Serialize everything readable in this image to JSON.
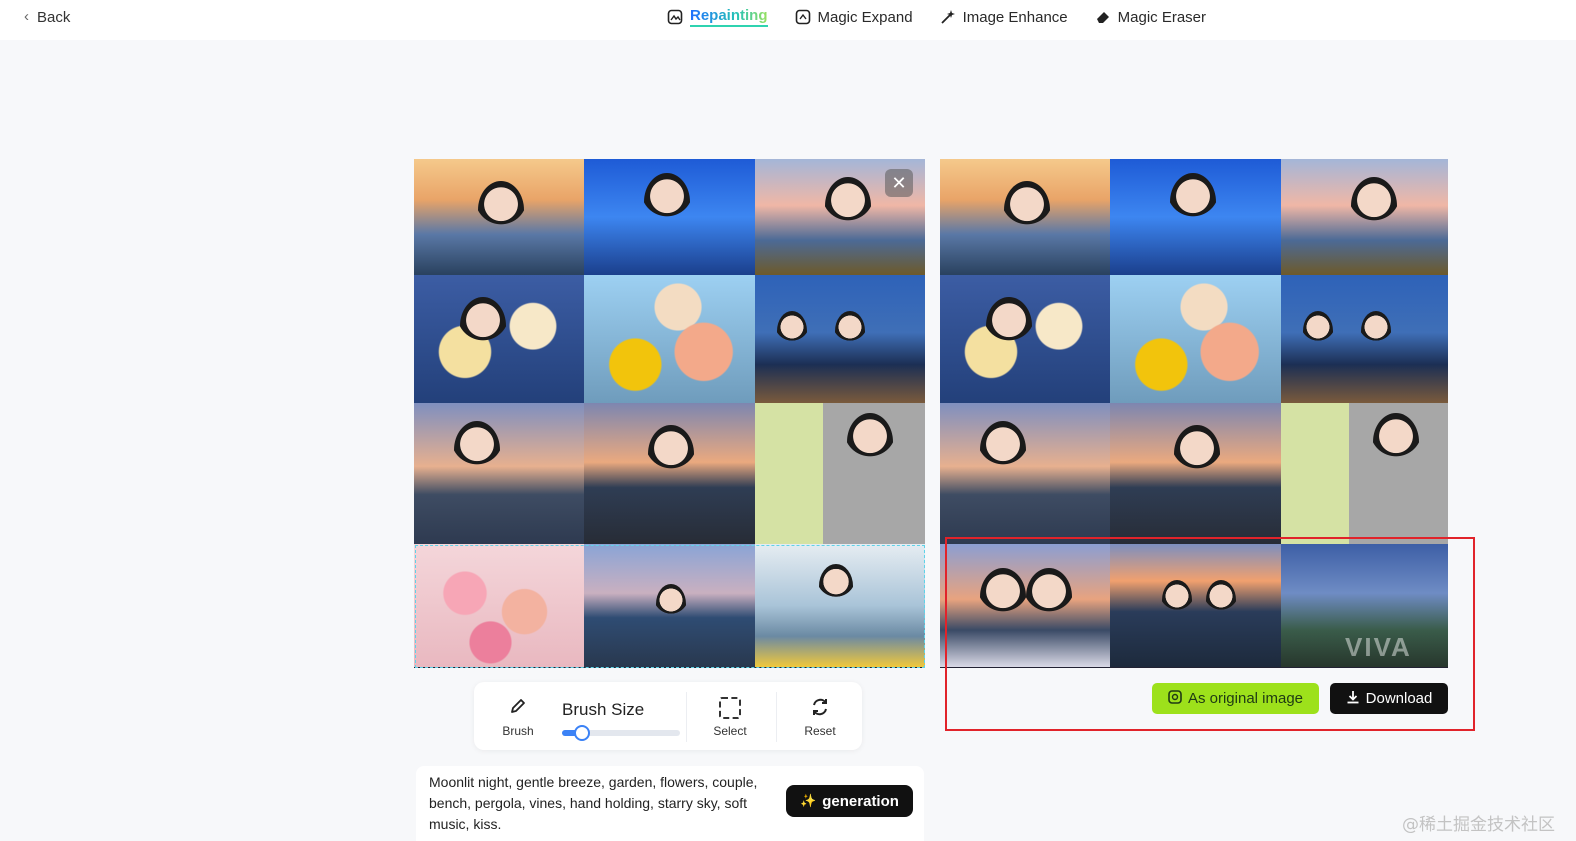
{
  "nav": {
    "back_label": "Back",
    "tabs": [
      {
        "label": "Repainting",
        "icon": "repaint-icon",
        "active": true
      },
      {
        "label": "Magic Expand",
        "icon": "expand-icon",
        "active": false
      },
      {
        "label": "Image Enhance",
        "icon": "enhance-icon",
        "active": false
      },
      {
        "label": "Magic Eraser",
        "icon": "eraser-icon",
        "active": false
      }
    ]
  },
  "editor": {
    "close_symbol": "✕",
    "tools": {
      "brush_label": "Brush",
      "brush_size_label": "Brush Size",
      "brush_size_value": 0.15,
      "select_label": "Select",
      "reset_label": "Reset"
    },
    "prompt_text": "Moonlit night, gentle breeze, garden, flowers, couple, bench, pergola, vines, hand holding, starry sky, soft music, kiss.",
    "generate_label": "generation"
  },
  "result": {
    "as_original_label": "As original image",
    "download_label": "Download",
    "watermark": "VIVA"
  },
  "footer": {
    "site_mark": "@稀土掘金技术社区"
  },
  "colors": {
    "accent_green": "#9de11b",
    "accent_blue": "#3b82f6",
    "highlight_red": "#e1232a"
  }
}
